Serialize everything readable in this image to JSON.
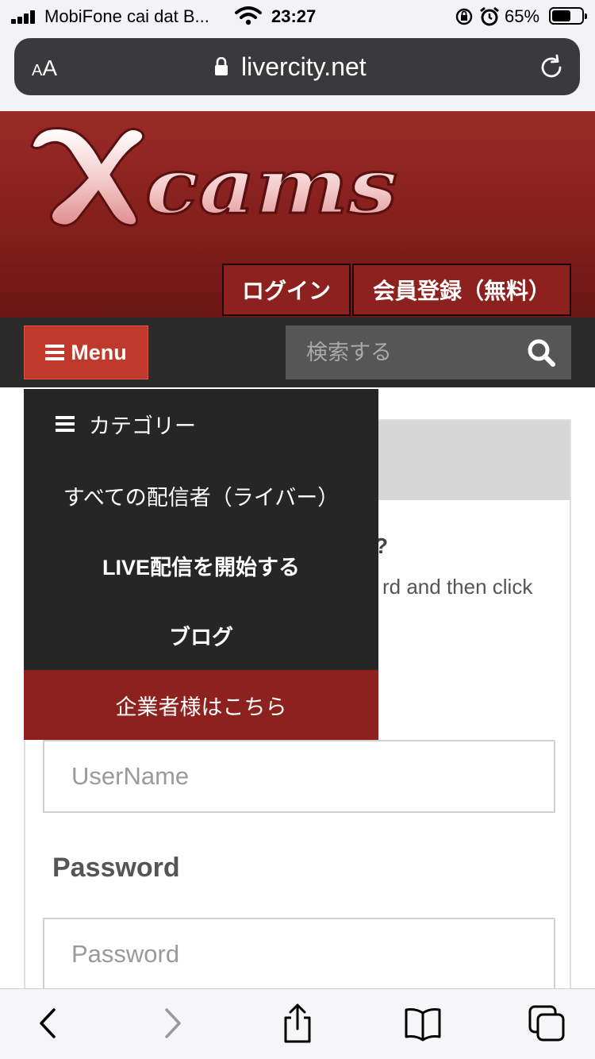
{
  "status_bar": {
    "carrier": "MobiFone cai dat B...",
    "time": "23:27",
    "battery_pct": "65%",
    "battery_level": 0.65,
    "icons": [
      "signal-icon",
      "wifi-icon",
      "rotation-lock-icon",
      "alarm-icon",
      "battery-icon"
    ]
  },
  "browser": {
    "text_size_label": "AA",
    "url": "livercity.net",
    "icons": [
      "lock-icon",
      "reload-icon"
    ]
  },
  "header": {
    "logo_text": "Xcams",
    "login_label": "ログイン",
    "register_label": "会員登録（無料）",
    "brand_color": "#8c211e"
  },
  "nav": {
    "menu_label": "Menu",
    "search_placeholder": "検索する",
    "menu_button_color": "#c0392b"
  },
  "dropdown": {
    "category_label": "カテゴリー",
    "items": [
      "すべての配信者（ライバー）",
      "LIVE配信を開始する",
      "ブログ"
    ],
    "corporate_label": "企業者様はこちら"
  },
  "content": {
    "heading_fragment": "?",
    "text_fragment": "rd and then click",
    "username_placeholder": "UserName",
    "password_label": "Password",
    "password_placeholder": "Password"
  },
  "toolbar": {
    "icons": [
      "back-icon",
      "forward-icon",
      "share-icon",
      "bookmarks-icon",
      "tabs-icon"
    ]
  }
}
